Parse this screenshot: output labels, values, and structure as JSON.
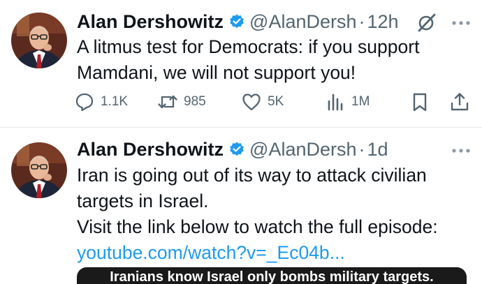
{
  "tweets": [
    {
      "name": "Alan Dershowitz",
      "handle": "@AlanDersh",
      "separator": "·",
      "time": "12h",
      "text_lines": [
        "A litmus test for Democrats: if you support",
        "Mamdani, we will not support you!"
      ],
      "stats": {
        "replies": "1.1K",
        "reposts": "985",
        "likes": "5K",
        "views": "1M"
      }
    },
    {
      "name": "Alan Dershowitz",
      "handle": "@AlanDersh",
      "separator": "·",
      "time": "1d",
      "text_lines": [
        "Iran is going out of its way to attack civilian",
        "targets in Israel.",
        "Visit the link below to watch the full episode:"
      ],
      "link": "youtube.com/watch?v=_Ec04b...",
      "media_caption": "Iranians know Israel only bombs military targets."
    }
  ],
  "icons": {
    "verified": "verified-badge-icon",
    "grok": "grok-icon",
    "more": "more-options-icon",
    "reply": "reply-icon",
    "repost": "repost-icon",
    "like": "heart-icon",
    "views": "views-icon",
    "bookmark": "bookmark-icon",
    "share": "share-icon"
  },
  "colors": {
    "text": "#0f1419",
    "secondary": "#536471",
    "link": "#1d9bf0",
    "verified": "#1d9bf0"
  }
}
